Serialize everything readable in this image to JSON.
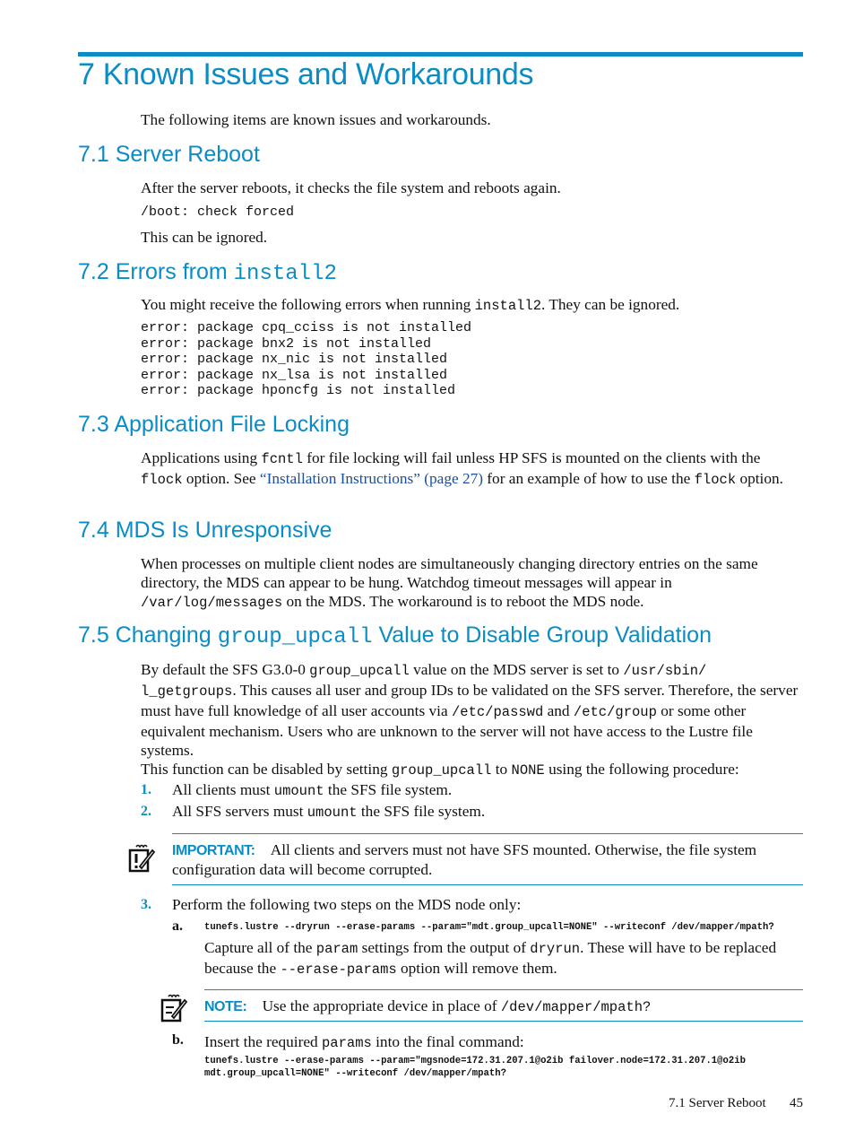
{
  "chapter": {
    "title": "7 Known Issues and Workarounds",
    "intro": "The following items are known issues and workarounds."
  },
  "s71": {
    "title": "7.1 Server Reboot",
    "p1": "After the server reboots, it checks the file system and reboots again.",
    "code": "/boot: check forced",
    "p2": "This can be ignored."
  },
  "s72": {
    "title_prefix": "7.2 Errors from ",
    "title_code": "install2",
    "p1_a": "You might receive the following errors when running ",
    "p1_code": "install2",
    "p1_b": ". They can be ignored.",
    "code_lines": [
      "error: package cpq_cciss is not installed",
      "error: package bnx2 is not installed",
      "error: package nx_nic is not installed",
      "error: package nx_lsa is not installed",
      "error: package hponcfg is not installed"
    ]
  },
  "s73": {
    "title": "7.3 Application File Locking",
    "t1": "Applications using ",
    "c1": "fcntl",
    "t2": " for file locking will fail unless HP SFS is mounted on the clients with the ",
    "c2": "flock",
    "t3": " option. See ",
    "link": "“Installation Instructions” (page 27)",
    "t4": " for an example of how to use the ",
    "c3": "flock",
    "t5": " option."
  },
  "s74": {
    "title": "7.4 MDS Is Unresponsive",
    "t1": "When processes on multiple client nodes are simultaneously changing directory entries on the same directory, the MDS can appear to be hung. Watchdog timeout messages will appear in ",
    "c1": "/var/log/messages",
    "t2": " on the MDS. The workaround is to reboot the MDS node."
  },
  "s75": {
    "title_a": "7.5 Changing ",
    "title_code": "group_upcall",
    "title_b": " Value to Disable Group Validation",
    "p1": {
      "t1": "By default the SFS G3.0-0 ",
      "c1": "group_upcall",
      "t2": " value on the MDS server is set to ",
      "c2": "/usr/sbin/ l_getgroups",
      "t3": ". This causes all user and group IDs to be validated on the SFS server. Therefore, the server must have full knowledge of all user accounts via ",
      "c3": "/etc/passwd",
      "t4": " and ",
      "c4": "/etc/group",
      "t5": " or some other equivalent mechanism. Users who are unknown to the server will not have access to the Lustre file systems."
    },
    "p2": {
      "t1": "This function can be disabled by setting ",
      "c1": "group_upcall",
      "t2": " to ",
      "c2": "NONE",
      "t3": " using the following procedure:"
    },
    "steps": [
      {
        "num": "1.",
        "t1": "All clients must ",
        "c1": "umount",
        "t2": " the SFS file system."
      },
      {
        "num": "2.",
        "t1": "All SFS servers must ",
        "c1": "umount",
        "t2": " the SFS file system."
      },
      {
        "num": "3.",
        "t1": "Perform the following two steps on the MDS node only:"
      }
    ],
    "important": {
      "label": "IMPORTANT:",
      "text": "All clients and servers must not have SFS mounted. Otherwise, the file system configuration data will become corrupted."
    },
    "substep_a": {
      "letter": "a.",
      "code": "tunefs.lustre --dryrun --erase-params --param=\"mdt.group_upcall=NONE\" --writeconf /dev/mapper/mpath?",
      "t1": "Capture all of the ",
      "c1": "param",
      "t2": " settings from the output of ",
      "c2": "dryrun",
      "t3": ". These will have to be replaced because the ",
      "c3": "--erase-params",
      "t4": " option will remove them."
    },
    "note": {
      "label": "NOTE:",
      "text": "Use the appropriate device in place of ",
      "code": "/dev/mapper/mpath?"
    },
    "substep_b": {
      "letter": "b.",
      "t1": "Insert the required ",
      "c1": "params",
      "t2": " into the final command:",
      "code_lines": [
        "tunefs.lustre --erase-params --param=\"mgsnode=172.31.207.1@o2ib failover.node=172.31.207.1@o2ib",
        "mdt.group_upcall=NONE\" --writeconf /dev/mapper/mpath?"
      ]
    }
  },
  "footer": {
    "section": "7.1 Server Reboot",
    "page": "45"
  }
}
